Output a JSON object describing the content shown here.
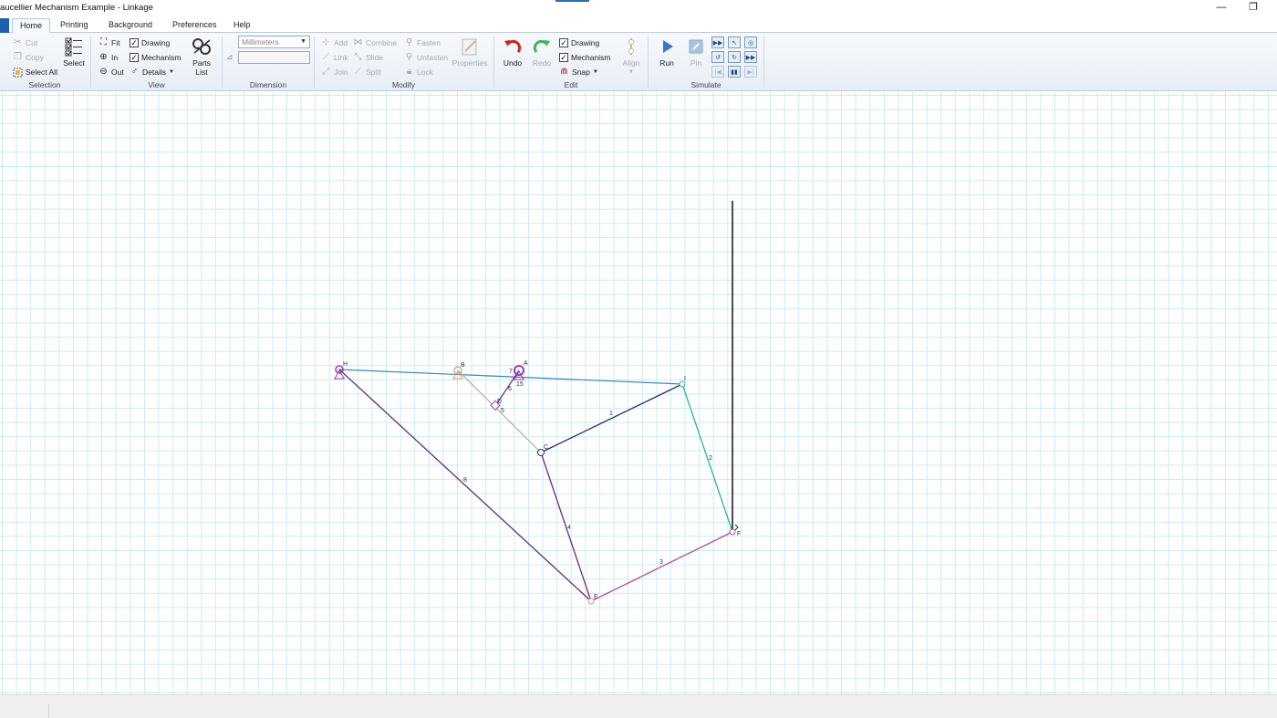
{
  "window": {
    "title": "aucellier Mechanism Example - Linkage",
    "minimize_glyph": "—",
    "restore_glyph": "❐"
  },
  "tabs": [
    {
      "label": "Home",
      "active": true
    },
    {
      "label": "Printing"
    },
    {
      "label": "Background"
    },
    {
      "label": "Preferences"
    },
    {
      "label": "Help"
    }
  ],
  "ribbon": {
    "selection": {
      "label": "Selection",
      "cut": "Cut",
      "copy": "Copy",
      "select_all": "Select All",
      "select": "Select"
    },
    "view": {
      "label": "View",
      "fit": "Fit",
      "in": "In",
      "out": "Out",
      "drawing": "Drawing",
      "mechanism": "Mechanism",
      "details": "Details",
      "parts_list_1": "Parts",
      "parts_list_2": "List"
    },
    "dimension": {
      "label": "Dimension",
      "units": "Millimeters",
      "value": ""
    },
    "modify": {
      "label": "Modify",
      "add": "Add",
      "link": "Link",
      "join": "Join",
      "combine": "Combine",
      "slide": "Slide",
      "split": "Split",
      "fasten": "Fasten",
      "unfasten": "Unfasten",
      "lock": "Lock",
      "properties": "Properties"
    },
    "edit": {
      "label": "Edit",
      "undo": "Undo",
      "redo": "Redo",
      "drawing": "Drawing",
      "mechanism": "Mechanism",
      "snap": "Snap",
      "align": "Align"
    },
    "simulate": {
      "label": "Simulate",
      "run": "Run",
      "pin": "Pin"
    }
  },
  "colors": {
    "link_1": "#1f2a78",
    "link_2": "#2bb3a3",
    "link_3": "#b04bb0",
    "link_4": "#6a2a8a",
    "link_8": "#5a2d82",
    "link_top": "#3a86b8",
    "link_bd": "#b5ab88",
    "anchor": "#a03cb0",
    "trace": "#111111"
  },
  "mechanism": {
    "points": {
      "H": "H",
      "B": "B",
      "A": "A",
      "I": "I",
      "C": "C",
      "D": "D",
      "E": "E",
      "F": "F"
    },
    "link_labels": {
      "l1": "1",
      "l2": "2",
      "l3": "3",
      "l4": "4",
      "l5": "5",
      "l6": "6",
      "l7": "7",
      "l8": "8",
      "l15": "15"
    }
  }
}
